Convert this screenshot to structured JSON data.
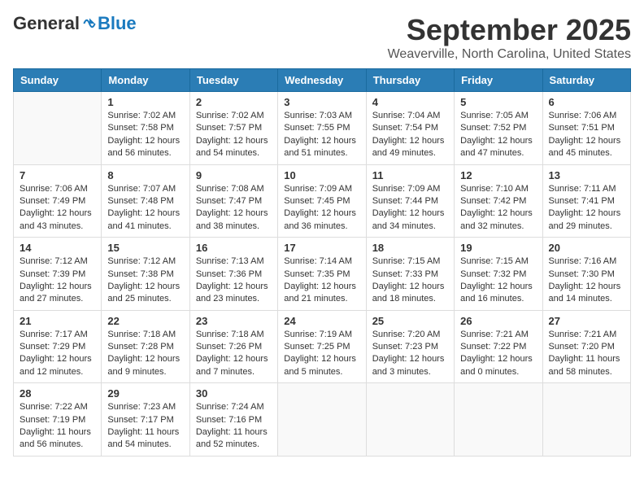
{
  "header": {
    "logo_general": "General",
    "logo_blue": "Blue",
    "month_title": "September 2025",
    "location": "Weaverville, North Carolina, United States"
  },
  "calendar": {
    "headers": [
      "Sunday",
      "Monday",
      "Tuesday",
      "Wednesday",
      "Thursday",
      "Friday",
      "Saturday"
    ],
    "weeks": [
      [
        {
          "day": "",
          "lines": []
        },
        {
          "day": "1",
          "lines": [
            "Sunrise: 7:02 AM",
            "Sunset: 7:58 PM",
            "Daylight: 12 hours",
            "and 56 minutes."
          ]
        },
        {
          "day": "2",
          "lines": [
            "Sunrise: 7:02 AM",
            "Sunset: 7:57 PM",
            "Daylight: 12 hours",
            "and 54 minutes."
          ]
        },
        {
          "day": "3",
          "lines": [
            "Sunrise: 7:03 AM",
            "Sunset: 7:55 PM",
            "Daylight: 12 hours",
            "and 51 minutes."
          ]
        },
        {
          "day": "4",
          "lines": [
            "Sunrise: 7:04 AM",
            "Sunset: 7:54 PM",
            "Daylight: 12 hours",
            "and 49 minutes."
          ]
        },
        {
          "day": "5",
          "lines": [
            "Sunrise: 7:05 AM",
            "Sunset: 7:52 PM",
            "Daylight: 12 hours",
            "and 47 minutes."
          ]
        },
        {
          "day": "6",
          "lines": [
            "Sunrise: 7:06 AM",
            "Sunset: 7:51 PM",
            "Daylight: 12 hours",
            "and 45 minutes."
          ]
        }
      ],
      [
        {
          "day": "7",
          "lines": [
            "Sunrise: 7:06 AM",
            "Sunset: 7:49 PM",
            "Daylight: 12 hours",
            "and 43 minutes."
          ]
        },
        {
          "day": "8",
          "lines": [
            "Sunrise: 7:07 AM",
            "Sunset: 7:48 PM",
            "Daylight: 12 hours",
            "and 41 minutes."
          ]
        },
        {
          "day": "9",
          "lines": [
            "Sunrise: 7:08 AM",
            "Sunset: 7:47 PM",
            "Daylight: 12 hours",
            "and 38 minutes."
          ]
        },
        {
          "day": "10",
          "lines": [
            "Sunrise: 7:09 AM",
            "Sunset: 7:45 PM",
            "Daylight: 12 hours",
            "and 36 minutes."
          ]
        },
        {
          "day": "11",
          "lines": [
            "Sunrise: 7:09 AM",
            "Sunset: 7:44 PM",
            "Daylight: 12 hours",
            "and 34 minutes."
          ]
        },
        {
          "day": "12",
          "lines": [
            "Sunrise: 7:10 AM",
            "Sunset: 7:42 PM",
            "Daylight: 12 hours",
            "and 32 minutes."
          ]
        },
        {
          "day": "13",
          "lines": [
            "Sunrise: 7:11 AM",
            "Sunset: 7:41 PM",
            "Daylight: 12 hours",
            "and 29 minutes."
          ]
        }
      ],
      [
        {
          "day": "14",
          "lines": [
            "Sunrise: 7:12 AM",
            "Sunset: 7:39 PM",
            "Daylight: 12 hours",
            "and 27 minutes."
          ]
        },
        {
          "day": "15",
          "lines": [
            "Sunrise: 7:12 AM",
            "Sunset: 7:38 PM",
            "Daylight: 12 hours",
            "and 25 minutes."
          ]
        },
        {
          "day": "16",
          "lines": [
            "Sunrise: 7:13 AM",
            "Sunset: 7:36 PM",
            "Daylight: 12 hours",
            "and 23 minutes."
          ]
        },
        {
          "day": "17",
          "lines": [
            "Sunrise: 7:14 AM",
            "Sunset: 7:35 PM",
            "Daylight: 12 hours",
            "and 21 minutes."
          ]
        },
        {
          "day": "18",
          "lines": [
            "Sunrise: 7:15 AM",
            "Sunset: 7:33 PM",
            "Daylight: 12 hours",
            "and 18 minutes."
          ]
        },
        {
          "day": "19",
          "lines": [
            "Sunrise: 7:15 AM",
            "Sunset: 7:32 PM",
            "Daylight: 12 hours",
            "and 16 minutes."
          ]
        },
        {
          "day": "20",
          "lines": [
            "Sunrise: 7:16 AM",
            "Sunset: 7:30 PM",
            "Daylight: 12 hours",
            "and 14 minutes."
          ]
        }
      ],
      [
        {
          "day": "21",
          "lines": [
            "Sunrise: 7:17 AM",
            "Sunset: 7:29 PM",
            "Daylight: 12 hours",
            "and 12 minutes."
          ]
        },
        {
          "day": "22",
          "lines": [
            "Sunrise: 7:18 AM",
            "Sunset: 7:28 PM",
            "Daylight: 12 hours",
            "and 9 minutes."
          ]
        },
        {
          "day": "23",
          "lines": [
            "Sunrise: 7:18 AM",
            "Sunset: 7:26 PM",
            "Daylight: 12 hours",
            "and 7 minutes."
          ]
        },
        {
          "day": "24",
          "lines": [
            "Sunrise: 7:19 AM",
            "Sunset: 7:25 PM",
            "Daylight: 12 hours",
            "and 5 minutes."
          ]
        },
        {
          "day": "25",
          "lines": [
            "Sunrise: 7:20 AM",
            "Sunset: 7:23 PM",
            "Daylight: 12 hours",
            "and 3 minutes."
          ]
        },
        {
          "day": "26",
          "lines": [
            "Sunrise: 7:21 AM",
            "Sunset: 7:22 PM",
            "Daylight: 12 hours",
            "and 0 minutes."
          ]
        },
        {
          "day": "27",
          "lines": [
            "Sunrise: 7:21 AM",
            "Sunset: 7:20 PM",
            "Daylight: 11 hours",
            "and 58 minutes."
          ]
        }
      ],
      [
        {
          "day": "28",
          "lines": [
            "Sunrise: 7:22 AM",
            "Sunset: 7:19 PM",
            "Daylight: 11 hours",
            "and 56 minutes."
          ]
        },
        {
          "day": "29",
          "lines": [
            "Sunrise: 7:23 AM",
            "Sunset: 7:17 PM",
            "Daylight: 11 hours",
            "and 54 minutes."
          ]
        },
        {
          "day": "30",
          "lines": [
            "Sunrise: 7:24 AM",
            "Sunset: 7:16 PM",
            "Daylight: 11 hours",
            "and 52 minutes."
          ]
        },
        {
          "day": "",
          "lines": []
        },
        {
          "day": "",
          "lines": []
        },
        {
          "day": "",
          "lines": []
        },
        {
          "day": "",
          "lines": []
        }
      ]
    ]
  }
}
